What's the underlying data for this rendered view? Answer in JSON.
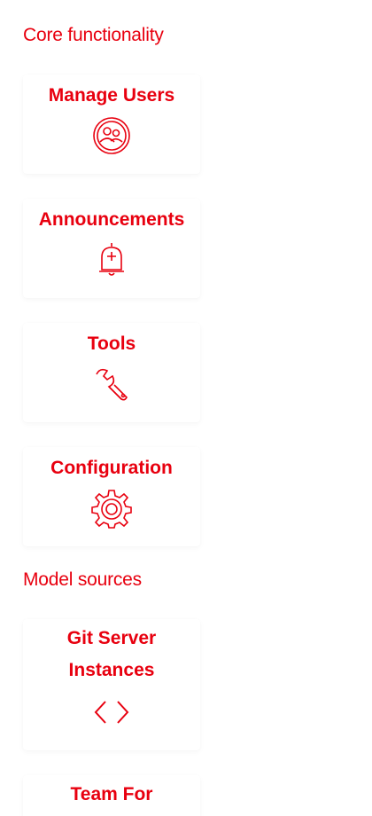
{
  "sections": {
    "core": {
      "title": "Core functionality"
    },
    "model": {
      "title": "Model sources"
    }
  },
  "cards": {
    "manage_users": {
      "label": "Manage Users",
      "icon": "users-icon"
    },
    "announcements": {
      "label": "Announcements",
      "icon": "bell-icon"
    },
    "tools": {
      "label": "Tools",
      "icon": "wrench-icon"
    },
    "configuration": {
      "label": "Configuration",
      "icon": "gear-icon"
    },
    "git_server": {
      "label": "Git Server Instances",
      "icon": "code-icon"
    },
    "team_for": {
      "label": "Team For",
      "icon": ""
    }
  },
  "colors": {
    "accent": "#e8000f",
    "background": "#ffffff"
  }
}
